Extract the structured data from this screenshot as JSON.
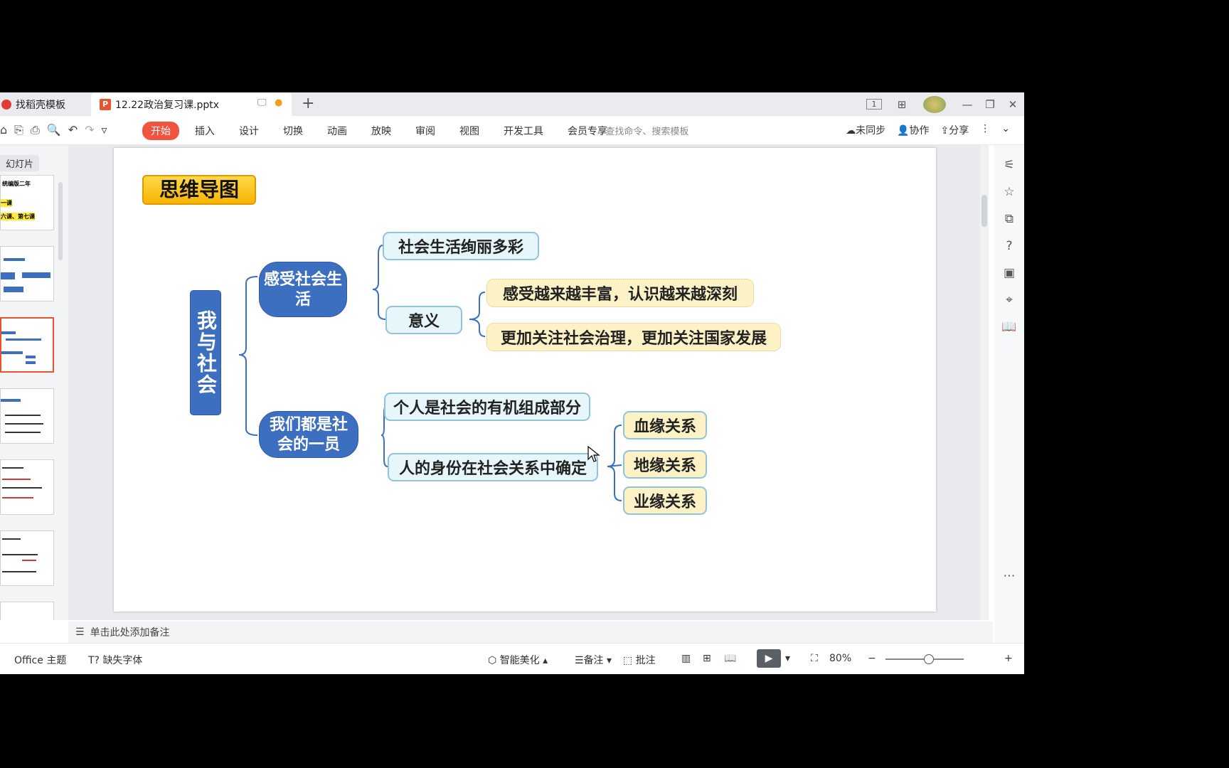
{
  "tabs": {
    "tab1": "找稻壳模板",
    "tab2": "12.22政治复习课.pptx",
    "logo_p": "P",
    "add": "+"
  },
  "window": {
    "view_badge": "1",
    "minimize": "—",
    "restore": "❐",
    "close": "✕"
  },
  "ribbon": {
    "menu": [
      "开始",
      "插入",
      "设计",
      "切换",
      "动画",
      "放映",
      "审阅",
      "视图",
      "开发工具",
      "会员专享"
    ],
    "search_placeholder": "查找命令、搜索模板",
    "unsync": "未同步",
    "collab": "协作",
    "share": "分享"
  },
  "left_panel": {
    "label": "幻灯片",
    "thumb1_title": "统编版二年",
    "thumb1_line1": "一课",
    "thumb1_line2": "六课、第七课"
  },
  "slide": {
    "title": "思维导图",
    "root": "我与社会",
    "branch1": "感受社会生活",
    "branch1_sub1": "社会生活绚丽多彩",
    "branch1_sub2": "意义",
    "branch1_leaf1": "感受越来越丰富，认识越来越深刻",
    "branch1_leaf2": "更加关注社会治理，更加关注国家发展",
    "branch2": "我们都是社会的一员",
    "branch2_sub1": "个人是社会的有机组成部分",
    "branch2_sub2": "人的身份在社会关系中确定",
    "branch2_leaf1": "血缘关系",
    "branch2_leaf2": "地缘关系",
    "branch2_leaf3": "业缘关系"
  },
  "notes": {
    "placeholder": "单击此处添加备注"
  },
  "status": {
    "theme": "Office 主题",
    "missing_font": "缺失字体",
    "beautify": "智能美化",
    "notes": "备注",
    "comment": "批注",
    "zoom": "80%",
    "zoom_minus": "−",
    "zoom_plus": "+"
  },
  "icons": {
    "sidebar": [
      "sliders-icon",
      "star-icon",
      "copy-icon",
      "help-icon",
      "image-icon",
      "location-icon",
      "book-icon",
      "more-icon"
    ]
  }
}
